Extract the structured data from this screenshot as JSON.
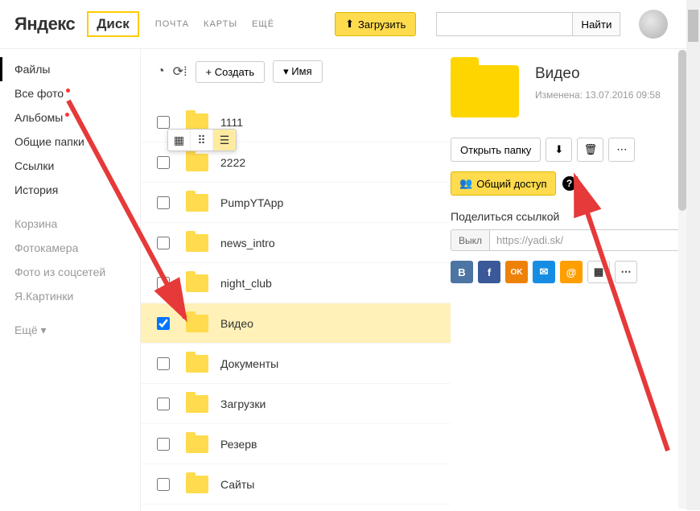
{
  "header": {
    "brand": "Яндекс",
    "app": "Диск",
    "nav": [
      "ПОЧТА",
      "КАРТЫ",
      "ЕЩЁ"
    ],
    "upload": "Загрузить",
    "search_btn": "Найти"
  },
  "sidebar": {
    "items": [
      {
        "label": "Файлы",
        "active": true
      },
      {
        "label": "Все фото",
        "dot": true
      },
      {
        "label": "Альбомы",
        "dot": true
      },
      {
        "label": "Общие папки"
      },
      {
        "label": "Ссылки"
      },
      {
        "label": "История"
      }
    ],
    "secondary": [
      {
        "label": "Корзина"
      },
      {
        "label": "Фотокамера"
      },
      {
        "label": "Фото из соцсетей"
      },
      {
        "label": "Я.Картинки"
      }
    ],
    "more": "Ещё"
  },
  "toolbar": {
    "create": "Создать",
    "sort": "Имя"
  },
  "files": [
    {
      "name": "1111"
    },
    {
      "name": "2222"
    },
    {
      "name": "PumpYTApp"
    },
    {
      "name": "news_intro"
    },
    {
      "name": "night_club"
    },
    {
      "name": "Видео",
      "selected": true
    },
    {
      "name": "Документы"
    },
    {
      "name": "Загрузки"
    },
    {
      "name": "Резерв"
    },
    {
      "name": "Сайты"
    }
  ],
  "details": {
    "title": "Видео",
    "modified_label": "Изменена:",
    "modified_value": "13.07.2016 09:58",
    "open_btn": "Открыть папку",
    "share_btn": "Общий доступ",
    "link_label": "Поделиться ссылкой",
    "toggle": "Выкл",
    "link": "https://yadi.sk/"
  },
  "social": {
    "vk": {
      "bg": "#4c75a3",
      "txt": "B"
    },
    "fb": {
      "bg": "#3b5998",
      "txt": "f"
    },
    "ok": {
      "bg": "#ee8208",
      "txt": "OK"
    },
    "mail": {
      "bg": "#168de2",
      "txt": "✉"
    },
    "mm": {
      "bg": "#ff9e00",
      "txt": "@"
    },
    "qr": {
      "bg": "#fff",
      "txt": "▦"
    },
    "more": {
      "bg": "#fff",
      "txt": "⋯"
    }
  }
}
